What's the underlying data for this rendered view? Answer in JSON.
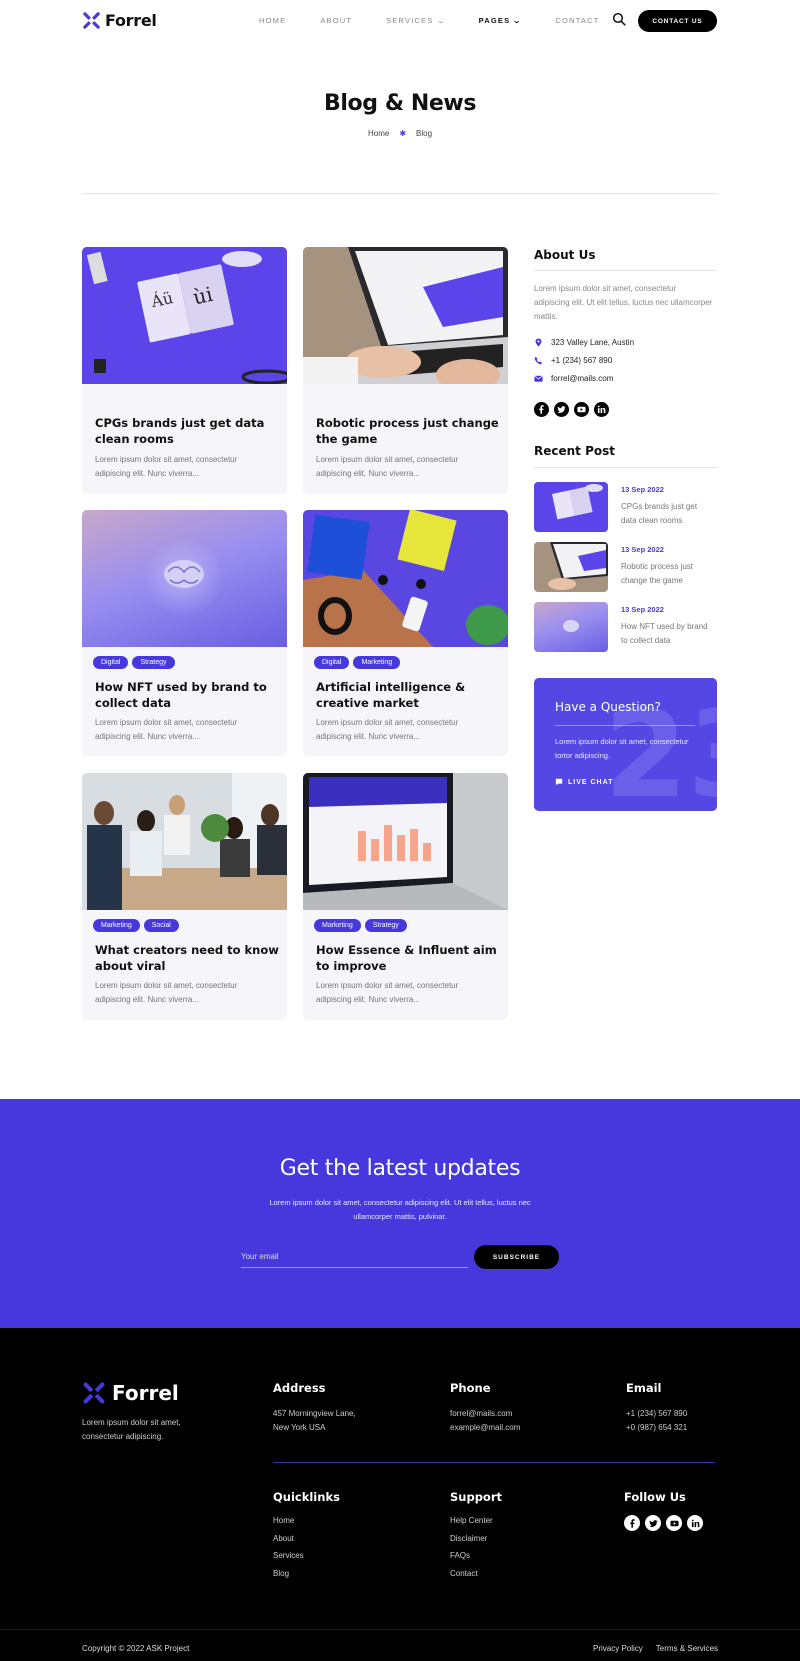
{
  "brand": {
    "name": "Forrel",
    "accent": "#4638dc"
  },
  "nav": {
    "items": [
      {
        "label": "Home"
      },
      {
        "label": "About"
      },
      {
        "label": "Services"
      },
      {
        "label": "Pages"
      },
      {
        "label": "Contact"
      }
    ],
    "contact_button": "Contact Us"
  },
  "page": {
    "title": "Blog & News",
    "breadcrumb": {
      "home": "Home",
      "current": "Blog"
    }
  },
  "posts": [
    {
      "title": "CPGs brands just get data clean rooms",
      "excerpt": "Lorem ipsum dolor sit amet, consectetur adipiscing elit. Nunc viverra...",
      "tags": []
    },
    {
      "title": "Robotic process just change the game",
      "excerpt": "Lorem ipsum dolor sit amet, consectetur adipiscing elit. Nunc viverra...",
      "tags": []
    },
    {
      "title": "How NFT used by brand to collect data",
      "excerpt": "Lorem ipsum dolor sit amet, consectetur adipiscing elit. Nunc viverra...",
      "tags": [
        "Digital",
        "Strategy"
      ]
    },
    {
      "title": "Artificial intelligence & creative market",
      "excerpt": "Lorem ipsum dolor sit amet, consectetur adipiscing elit. Nunc viverra...",
      "tags": [
        "Digital",
        "Marketing"
      ]
    },
    {
      "title": "What creators need to know about viral",
      "excerpt": "Lorem ipsum dolor sit amet, consectetur adipiscing elit. Nunc viverra...",
      "tags": [
        "Marketing",
        "Social"
      ]
    },
    {
      "title": "How Essence & Influent aim to improve",
      "excerpt": "Lorem ipsum dolor sit amet, consectetur adipiscing elit. Nunc viverra...",
      "tags": [
        "Marketing",
        "Strategy"
      ]
    }
  ],
  "sidebar": {
    "about": {
      "heading": "About Us",
      "text": "Lorem ipsum dolor sit amet, consectetur adipiscing elit. Ut elit tellus, luctus nec ullamcorper mattis.",
      "address": "323 Valley Lane, Austin",
      "phone": "+1 (234) 567 890",
      "email": "forrel@mails.com"
    },
    "recent": {
      "heading": "Recent Post",
      "items": [
        {
          "date": "13 Sep 2022",
          "title": "CPGs brands just get data clean rooms"
        },
        {
          "date": "13 Sep 2022",
          "title": "Robotic process just change the game"
        },
        {
          "date": "13 Sep 2022",
          "title": "How NFT used by brand to collect data"
        }
      ]
    },
    "question": {
      "title": "Have a Question?",
      "text": "Lorem ipsum dolor sit amet, consectetur tortor adipiscing.",
      "cta": "LIVE CHAT"
    }
  },
  "newsletter": {
    "heading": "Get the latest updates",
    "text": "Lorem ipsum dolor sit amet, consectetur adipiscing elit. Ut elit tellus, luctus nec ullamcorper mattis, pulvinar.",
    "placeholder": "Your email",
    "button": "SUBSCRIBE"
  },
  "footer": {
    "tagline": "Lorem ipsum dolor sit amet, consectetur adipiscing.",
    "address": {
      "heading": "Address",
      "lines": [
        "457 Morningview Lane,",
        "New York USA"
      ]
    },
    "phone": {
      "heading": "Phone",
      "lines": [
        "forrel@mails.com",
        "example@mail.com"
      ]
    },
    "email": {
      "heading": "Email",
      "lines": [
        "+1 (234) 567 890",
        "+0 (987) 654 321"
      ]
    },
    "quicklinks": {
      "heading": "Quicklinks",
      "links": [
        "Home",
        "About",
        "Services",
        "Blog"
      ]
    },
    "support": {
      "heading": "Support",
      "links": [
        "Help Center",
        "Disclaimer",
        "FAQs",
        "Contact"
      ]
    },
    "follow": {
      "heading": "Follow Us"
    },
    "copyright": "Copyright © 2022 ASK Project",
    "legal": [
      "Privacy Policy",
      "Terms & Services"
    ]
  }
}
